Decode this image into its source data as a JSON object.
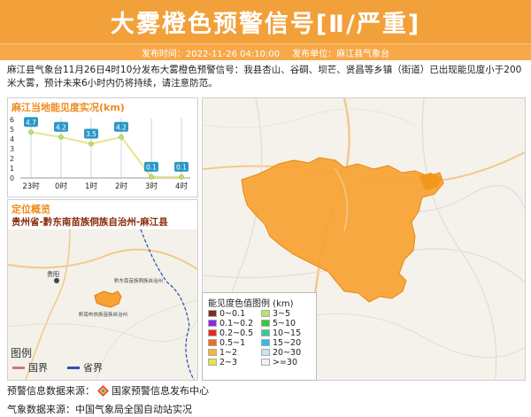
{
  "header": {
    "title": "大雾橙色预警信号[Ⅱ/严重]",
    "publish_time_label": "发布时间：2022-11-26 04:10:00",
    "publish_unit_label": "发布单位：麻江县气象台"
  },
  "description": "麻江县气象台11月26日4时10分发布大雾橙色预警信号：我县杏山、谷硐、坝芒、贤昌等乡镇（街道）已出现能见度小于200米大雾，预计未来6小时内仍将持续，请注意防范。",
  "visibility_panel": {
    "title": "麻江当地能见度实况(km)",
    "y_ticks": [
      "6",
      "5",
      "4",
      "3",
      "2",
      "1",
      "0"
    ]
  },
  "chart_data": {
    "type": "line",
    "title": "麻江当地能见度实况(km)",
    "categories": [
      "23时",
      "0时",
      "1时",
      "2时",
      "3时",
      "4时"
    ],
    "values": [
      4.7,
      4.2,
      3.5,
      4.2,
      0.1,
      0.1
    ],
    "value_labels": [
      "4.7",
      "4.2",
      "3.5",
      "4.2",
      "0.1",
      "0.1"
    ],
    "ylim": [
      0,
      6
    ],
    "grid": true
  },
  "location_panel": {
    "title": "定位概览",
    "region": "贵州省-黔东南苗族侗族自治州-麻江县",
    "map_labels": [
      "贵阳",
      "黔东南苗族侗族自治州",
      "黔南布依族苗族自治州"
    ],
    "legend_title": "图例",
    "legend_items": [
      {
        "label": "国界",
        "color": "#c97a7a"
      },
      {
        "label": "省界",
        "color": "#2d4fb5"
      }
    ]
  },
  "vis_legend": {
    "title": "能见度色值图例 (km)",
    "items": [
      {
        "label": "0~0.1",
        "color": "#7b2f1c"
      },
      {
        "label": "3~5",
        "color": "#b6e46a"
      },
      {
        "label": "0.1~0.2",
        "color": "#8a2be2"
      },
      {
        "label": "5~10",
        "color": "#33cc33"
      },
      {
        "label": "0.2~0.5",
        "color": "#e8271e"
      },
      {
        "label": "10~15",
        "color": "#33cc99"
      },
      {
        "label": "0.5~1",
        "color": "#f46b1c"
      },
      {
        "label": "15~20",
        "color": "#33bbee"
      },
      {
        "label": "1~2",
        "color": "#f7b733"
      },
      {
        "label": "20~30",
        "color": "#c8e6f7"
      },
      {
        "label": "2~3",
        "color": "#e9e14a"
      },
      {
        "label": ">=30",
        "color": "#f2f2f2"
      }
    ]
  },
  "colors": {
    "header_bg": "#f2a03a",
    "fog_area": "#f7a232",
    "chart_line": "#e8e38a",
    "label_bg": "#2c97c6"
  },
  "footer": {
    "warning_source": "预警信息数据来源：",
    "warning_center": "国家预警信息发布中心",
    "weather_source": "气象数据来源：中国气象局全国自动站实况"
  }
}
